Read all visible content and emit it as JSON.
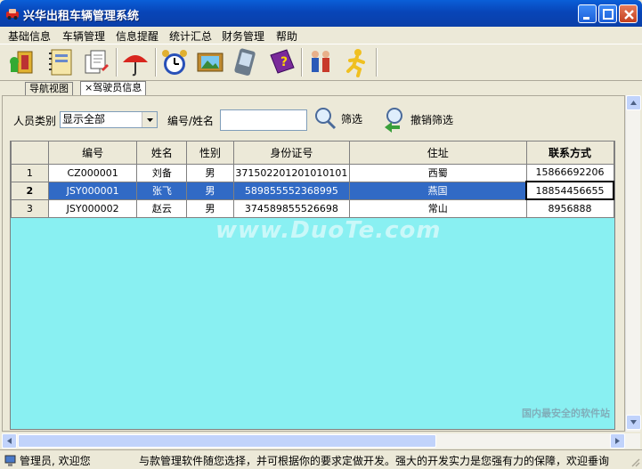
{
  "window": {
    "title": "兴华出租车辆管理系统"
  },
  "menu": [
    "基础信息",
    "车辆管理",
    "信息提醒",
    "统计汇总",
    "财务管理",
    "帮助"
  ],
  "toolbar": {
    "buttons": [
      "exit-icon",
      "notebook-icon",
      "documents-icon",
      "umbrella-icon",
      "alarm-clock-icon",
      "picture-frame-icon",
      "pda-icon",
      "help-book-icon",
      "users-icon",
      "running-man-icon"
    ]
  },
  "tabs": [
    {
      "label": "导航视图"
    },
    {
      "label": "驾驶员信息",
      "close": "×"
    }
  ],
  "filter": {
    "category_label": "人员类别",
    "category_value": "显示全部",
    "id_name_label": "编号/姓名",
    "id_name_value": "",
    "filter_button": "筛选",
    "cancel_filter_button": "撤销筛选"
  },
  "grid": {
    "columns": [
      "",
      "编号",
      "姓名",
      "性别",
      "身份证号",
      "住址",
      "联系方式"
    ],
    "rows": [
      {
        "num": "1",
        "id": "CZ000001",
        "name": "刘备",
        "gender": "男",
        "id_card": "371502201201010101",
        "address": "西蜀",
        "contact": "15866692206"
      },
      {
        "num": "2",
        "id": "JSY000001",
        "name": "张飞",
        "gender": "男",
        "id_card": "589855552368995",
        "address": "燕国",
        "contact": "18854456655"
      },
      {
        "num": "3",
        "id": "JSY000002",
        "name": "赵云",
        "gender": "男",
        "id_card": "374589855526698",
        "address": "常山",
        "contact": "8956888"
      }
    ],
    "selected_row": 2,
    "watermark": "www.DuoTe.com"
  },
  "status": {
    "user": "管理员, 欢迎您",
    "message": "与款管理软件随您选择，并可根据你的要求定做开发。强大的开发实力是您强有力的保障，欢迎垂询"
  },
  "brand_watermark": "国内最安全的软件站",
  "colors": {
    "titlebar": "#0a4fc8",
    "grid_background": "#89f0f2",
    "selected_row": "#316ac5"
  }
}
